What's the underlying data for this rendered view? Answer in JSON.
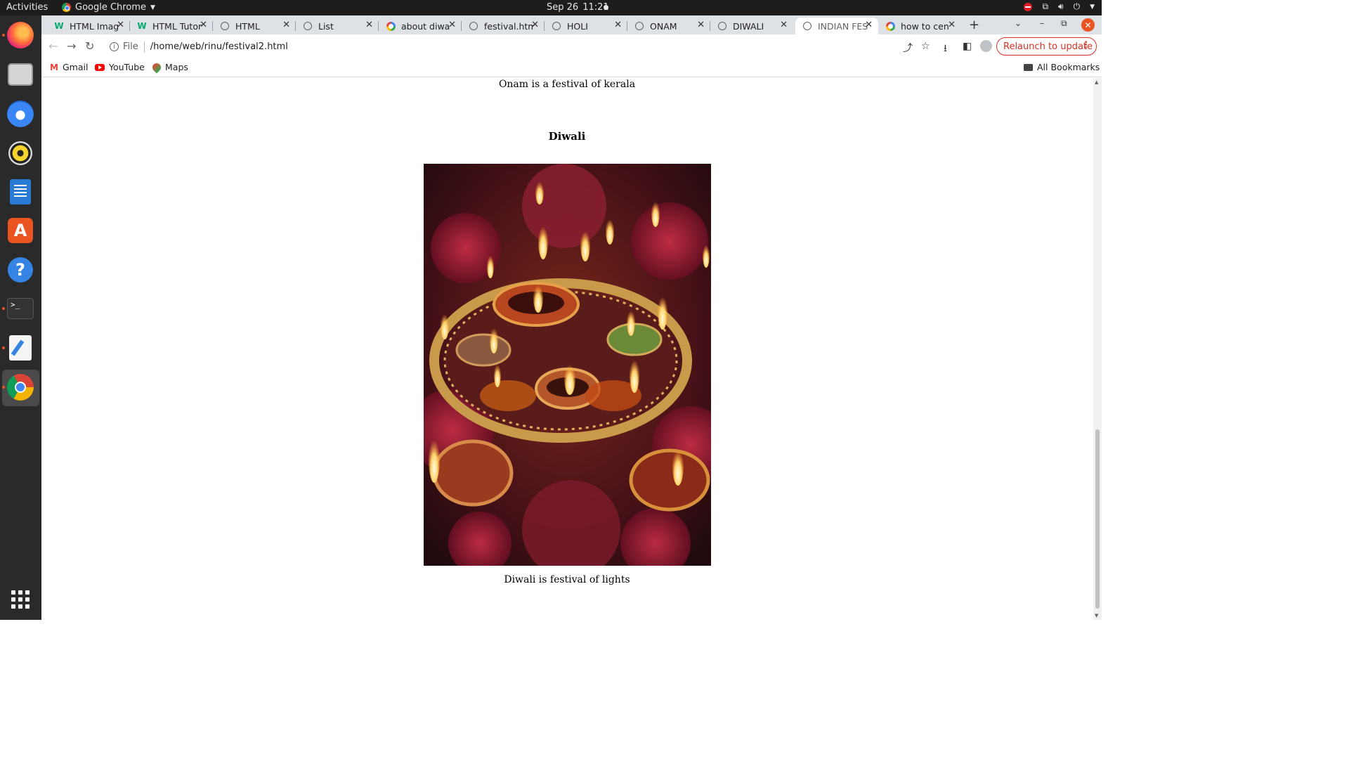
{
  "system_bar": {
    "activities": "Activities",
    "app_name": "Google Chrome",
    "date": "Sep 26",
    "time": "11:21"
  },
  "dock": {
    "items": [
      "firefox-icon",
      "files-icon",
      "thunderbird-icon",
      "rhythmbox-icon",
      "writer-icon",
      "app-store-icon",
      "help-icon",
      "terminal-icon",
      "text-editor-icon",
      "chrome-icon",
      "show-apps-icon"
    ]
  },
  "tabs": [
    {
      "title": "HTML Imag",
      "favicon": "w3schools-icon"
    },
    {
      "title": "HTML Tutor",
      "favicon": "w3schools-icon"
    },
    {
      "title": "HTML",
      "favicon": "globe-icon"
    },
    {
      "title": "List",
      "favicon": "globe-icon"
    },
    {
      "title": "about diwa",
      "favicon": "google-icon"
    },
    {
      "title": "festival.htm",
      "favicon": "globe-icon"
    },
    {
      "title": "HOLI",
      "favicon": "globe-icon"
    },
    {
      "title": "ONAM",
      "favicon": "globe-icon"
    },
    {
      "title": "DIWALI",
      "favicon": "globe-icon"
    },
    {
      "title": "INDIAN FES",
      "favicon": "globe-icon",
      "active": true
    },
    {
      "title": "how to cen",
      "favicon": "google-icon"
    }
  ],
  "toolbar": {
    "scheme_label": "File",
    "url": "/home/web/rinu/festival2.html",
    "relaunch_label": "Relaunch to update"
  },
  "bookmarks": {
    "items": [
      "Gmail",
      "YouTube",
      "Maps"
    ],
    "all_bookmarks": "All Bookmarks"
  },
  "page": {
    "onam_caption": "Onam is a festival of kerala",
    "diwali_heading": "Diwali",
    "diwali_caption": "Diwali is festival of lights"
  },
  "colors": {
    "relaunch": "#d93025",
    "ubuntu_orange": "#e95420"
  }
}
